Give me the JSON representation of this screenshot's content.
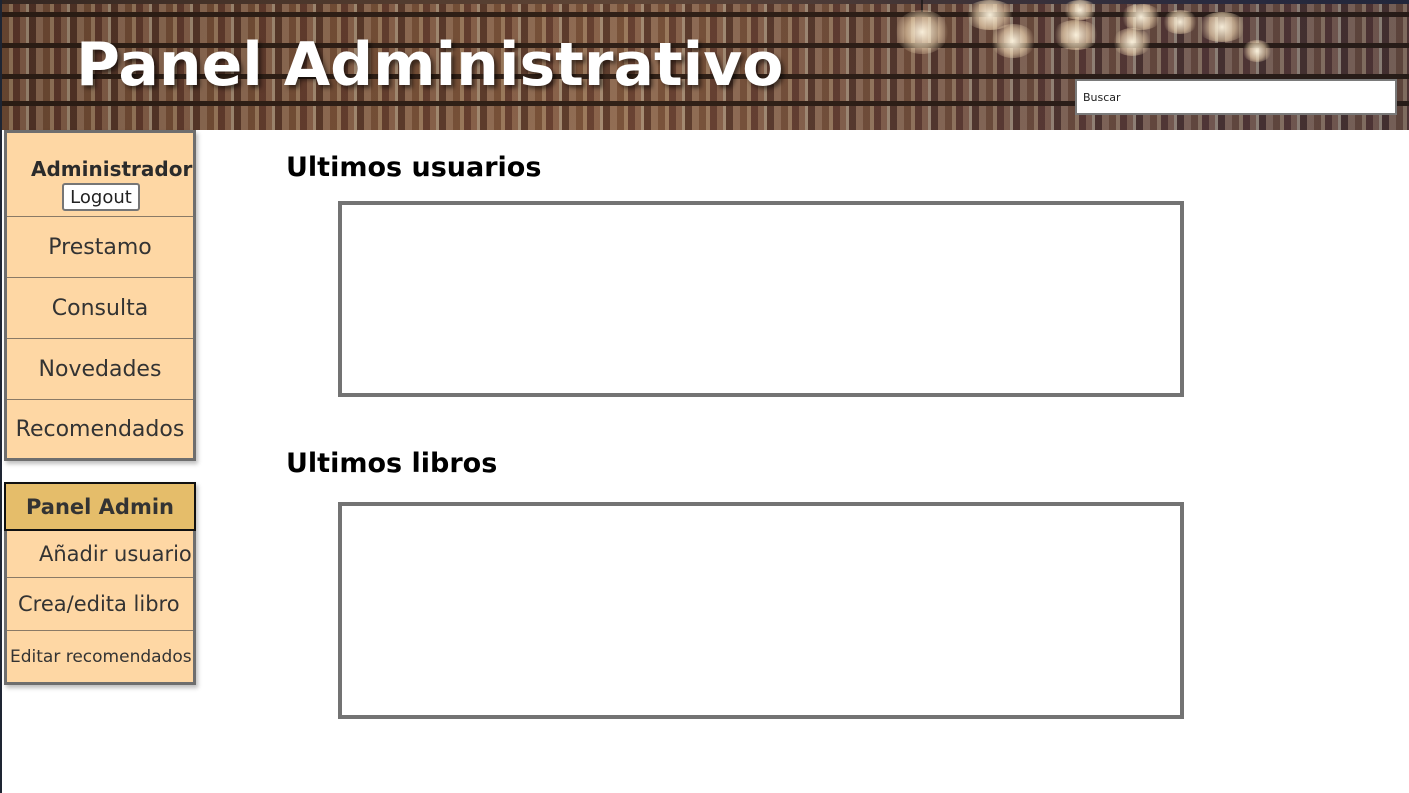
{
  "header": {
    "title": "Panel Administrativo",
    "search": {
      "placeholder": "Buscar",
      "value": ""
    }
  },
  "sidebar": {
    "user": {
      "name": "Administrador",
      "logout_label": "Logout"
    },
    "items": [
      {
        "label": "Prestamo"
      },
      {
        "label": "Consulta"
      },
      {
        "label": "Novedades"
      },
      {
        "label": "Recomendados"
      }
    ]
  },
  "admin_menu": {
    "title": "Panel Admin",
    "items": [
      {
        "label": "Añadir usuario"
      },
      {
        "label": "Crea/edita libro"
      },
      {
        "label": "Editar recomendados"
      }
    ]
  },
  "main": {
    "sections": [
      {
        "title": "Ultimos usuarios"
      },
      {
        "title": "Ultimos libros"
      }
    ]
  },
  "colors": {
    "sidebar_bg": "#fed7a4",
    "admin_header_bg": "#e5bd6a",
    "box_border": "#737373"
  }
}
